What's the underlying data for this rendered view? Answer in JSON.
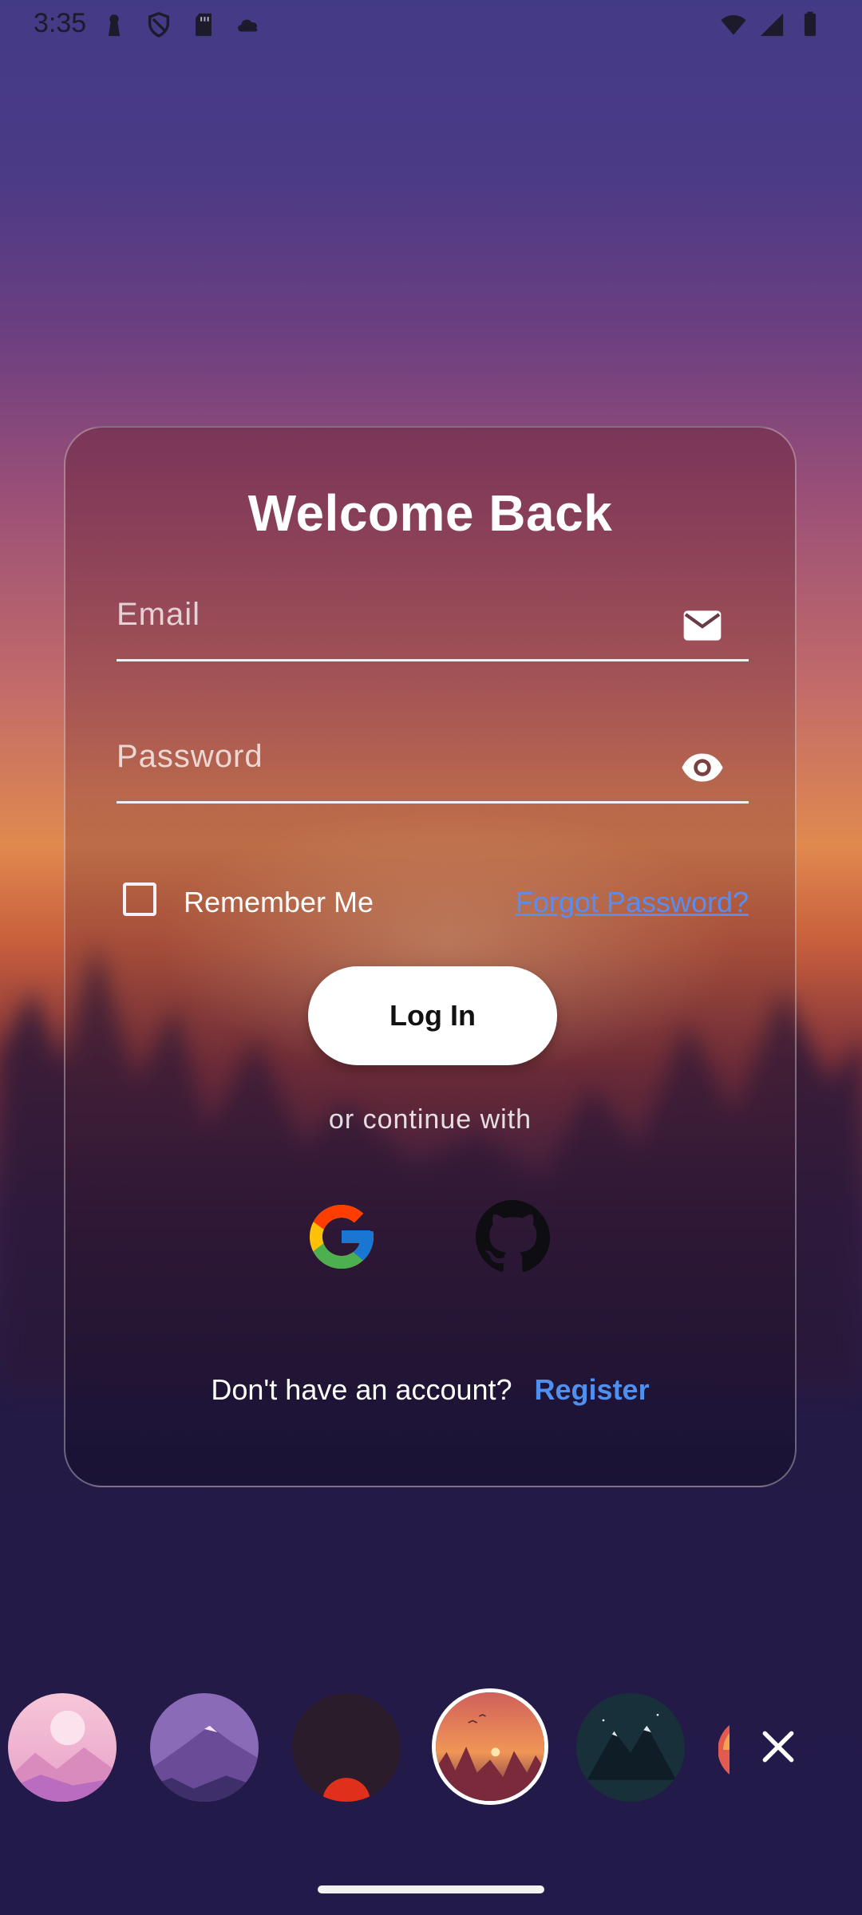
{
  "status_bar": {
    "time": "3:35",
    "left_icons": [
      "keyhole-icon",
      "shield-icon",
      "sd-card-icon",
      "cloud-icon"
    ],
    "right_icons": [
      "wifi-icon",
      "signal-icon",
      "battery-icon"
    ]
  },
  "login_card": {
    "title": "Welcome Back",
    "email": {
      "placeholder": "Email",
      "icon": "mail-icon"
    },
    "password": {
      "placeholder": "Password",
      "icon": "eye-icon"
    },
    "remember_label": "Remember Me",
    "remember_checked": false,
    "forgot_label": "Forgot Password?",
    "login_label": "Log In",
    "alt_text": "or continue with",
    "social": [
      "google-icon",
      "github-icon"
    ],
    "register_prompt": "Don't have an account?",
    "register_label": "Register"
  },
  "wallpaper_picker": {
    "items": [
      "pink-mountain-wallpaper",
      "purple-peak-wallpaper",
      "red-sun-wallpaper",
      "sunset-forest-wallpaper",
      "night-mountain-wallpaper",
      "partial-wallpaper"
    ],
    "selected": "sunset-forest-wallpaper",
    "close_icon": "close-icon"
  },
  "colors": {
    "accent_link": "#4f8ff0",
    "forgot_link": "#5a8df0",
    "button_bg": "#ffffff"
  }
}
